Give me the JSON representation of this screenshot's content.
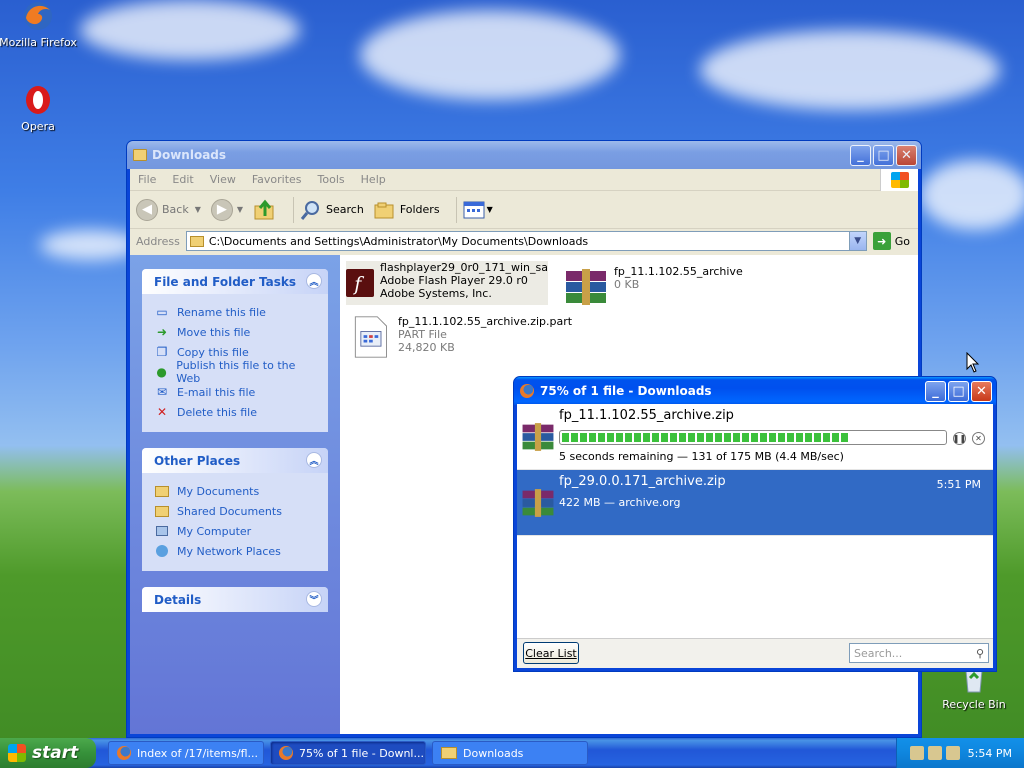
{
  "desktop": {
    "icons": [
      {
        "label": "Mozilla Firefox"
      },
      {
        "label": "Opera"
      },
      {
        "label": "Recycle Bin"
      }
    ]
  },
  "explorer": {
    "title": "Downloads",
    "menu": [
      "File",
      "Edit",
      "View",
      "Favorites",
      "Tools",
      "Help"
    ],
    "toolbar": {
      "back": "Back",
      "search": "Search",
      "folders": "Folders"
    },
    "address": {
      "label": "Address",
      "path": "C:\\Documents and Settings\\Administrator\\My Documents\\Downloads",
      "go": "Go"
    },
    "tasks": {
      "title": "File and Folder Tasks",
      "items": [
        "Rename this file",
        "Move this file",
        "Copy this file",
        "Publish this file to the Web",
        "E-mail this file",
        "Delete this file"
      ]
    },
    "places": {
      "title": "Other Places",
      "items": [
        "My Documents",
        "Shared Documents",
        "My Computer",
        "My Network Places"
      ]
    },
    "details": {
      "title": "Details"
    },
    "files": [
      {
        "name": "flashplayer29_0r0_171_win_sa",
        "line2": "Adobe Flash Player 29.0 r0",
        "line3": "Adobe Systems, Inc."
      },
      {
        "name": "fp_11.1.102.55_archive",
        "line2": "0 KB"
      },
      {
        "name": "fp_11.1.102.55_archive.zip.part",
        "line2": "PART File",
        "line3": "24,820 KB"
      }
    ]
  },
  "downloads": {
    "title": "75% of 1 file - Downloads",
    "items": [
      {
        "name": "fp_11.1.102.55_archive.zip",
        "status": "5 seconds remaining — 131 of 175 MB (4.4 MB/sec)",
        "progress": 0.75
      },
      {
        "name": "fp_29.0.0.171_archive.zip",
        "status": "422 MB — archive.org",
        "time": "5:51 PM"
      }
    ],
    "clear_label": "Clear List",
    "search_placeholder": "Search..."
  },
  "taskbar": {
    "start": "start",
    "tasks": [
      "Index of /17/items/fl...",
      "75% of 1 file - Downl...",
      "Downloads"
    ],
    "clock": "5:54 PM"
  },
  "colors": {
    "xp_blue": "#0053ee",
    "link_blue": "#215dc6",
    "progress_green": "#3bc13b"
  }
}
